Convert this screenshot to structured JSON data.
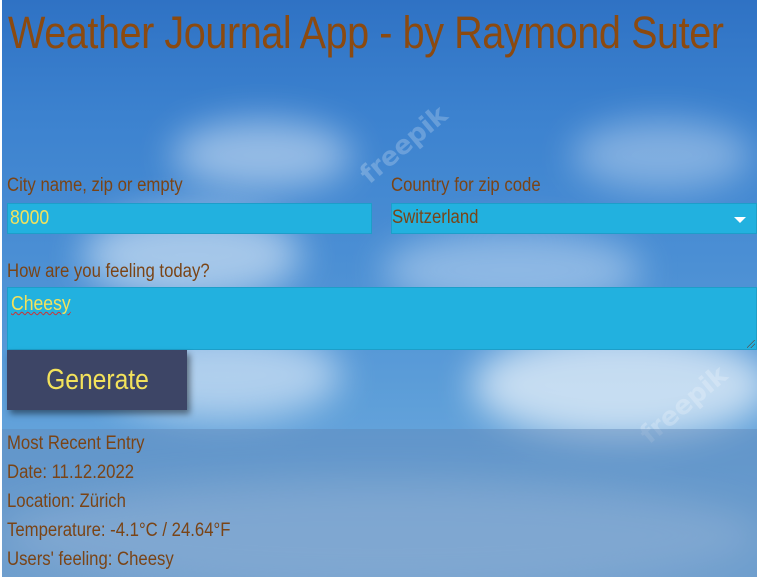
{
  "header": {
    "title": "Weather Journal App - by Raymond Suter"
  },
  "form": {
    "city_label": "City name, zip or empty",
    "city_value": "8000",
    "country_label": "Country for zip code",
    "country_value": "Switzerland",
    "feeling_label": "How are you feeling today?",
    "feeling_value": "Cheesy",
    "generate_label": "Generate"
  },
  "entry": {
    "heading": "Most Recent Entry",
    "date": "Date: 11.12.2022",
    "location": "Location: Zürich",
    "temperature": "Temperature: -4.1°C / 24.64°F",
    "feeling": "Users' feeling: Cheesy"
  },
  "background": {
    "watermark": "freepik"
  },
  "colors": {
    "title": "#8b4a10",
    "label": "#7a4416",
    "input_bg": "#22b1df",
    "input_text": "#f3e25b",
    "button_bg": "#3d4566",
    "button_text": "#f3e25b"
  },
  "icons": {
    "select_arrow": "chevron-down-icon"
  }
}
